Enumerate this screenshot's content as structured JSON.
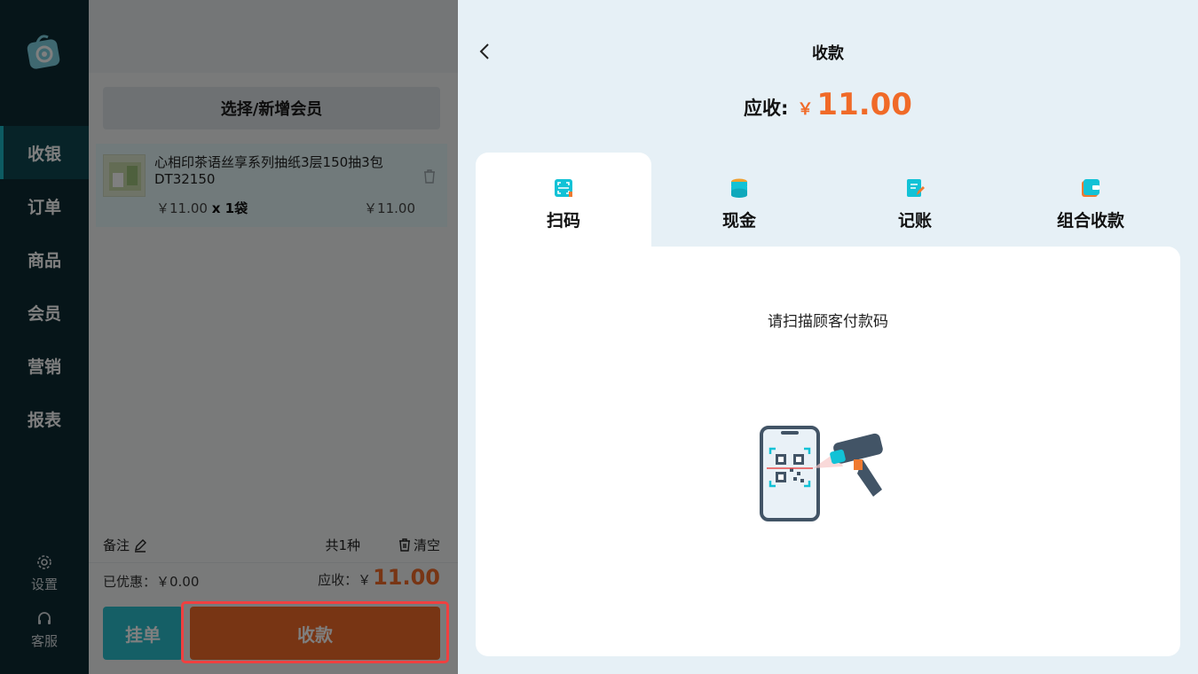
{
  "sidebar": {
    "nav": [
      {
        "label": "收银",
        "active": true
      },
      {
        "label": "订单"
      },
      {
        "label": "商品"
      },
      {
        "label": "会员"
      },
      {
        "label": "营销"
      },
      {
        "label": "报表"
      }
    ],
    "settings_label": "设置",
    "support_label": "客服"
  },
  "order": {
    "member_button": "选择/新增会员",
    "item": {
      "name": "心相印茶语丝享系列抽纸3层150抽3包DT32150",
      "unit_price": "￥11.00",
      "quantity": "x 1袋",
      "subtotal": "￥11.00"
    },
    "remark_label": "备注",
    "count_label": "共1种",
    "clear_label": "清空",
    "discount_label": "已优惠：￥0.00",
    "receivable_label": "应收：￥",
    "receivable_amount": "11.00",
    "hold_button": "挂单",
    "checkout_button": "收款"
  },
  "payment": {
    "title": "收款",
    "due_label": "应收:",
    "due_currency": "￥",
    "due_amount": "11.00",
    "tabs": [
      {
        "label": "扫码",
        "icon": "scan-icon",
        "active": true
      },
      {
        "label": "现金",
        "icon": "coins-icon"
      },
      {
        "label": "记账",
        "icon": "ledger-icon"
      },
      {
        "label": "组合收款",
        "icon": "wallet-icon"
      }
    ],
    "scan_prompt": "请扫描顾客付款码"
  },
  "colors": {
    "sidebar": "#0d2b33",
    "accent_teal": "#1ab6c4",
    "accent_orange": "#f06a28",
    "highlight_red": "#f04040"
  }
}
